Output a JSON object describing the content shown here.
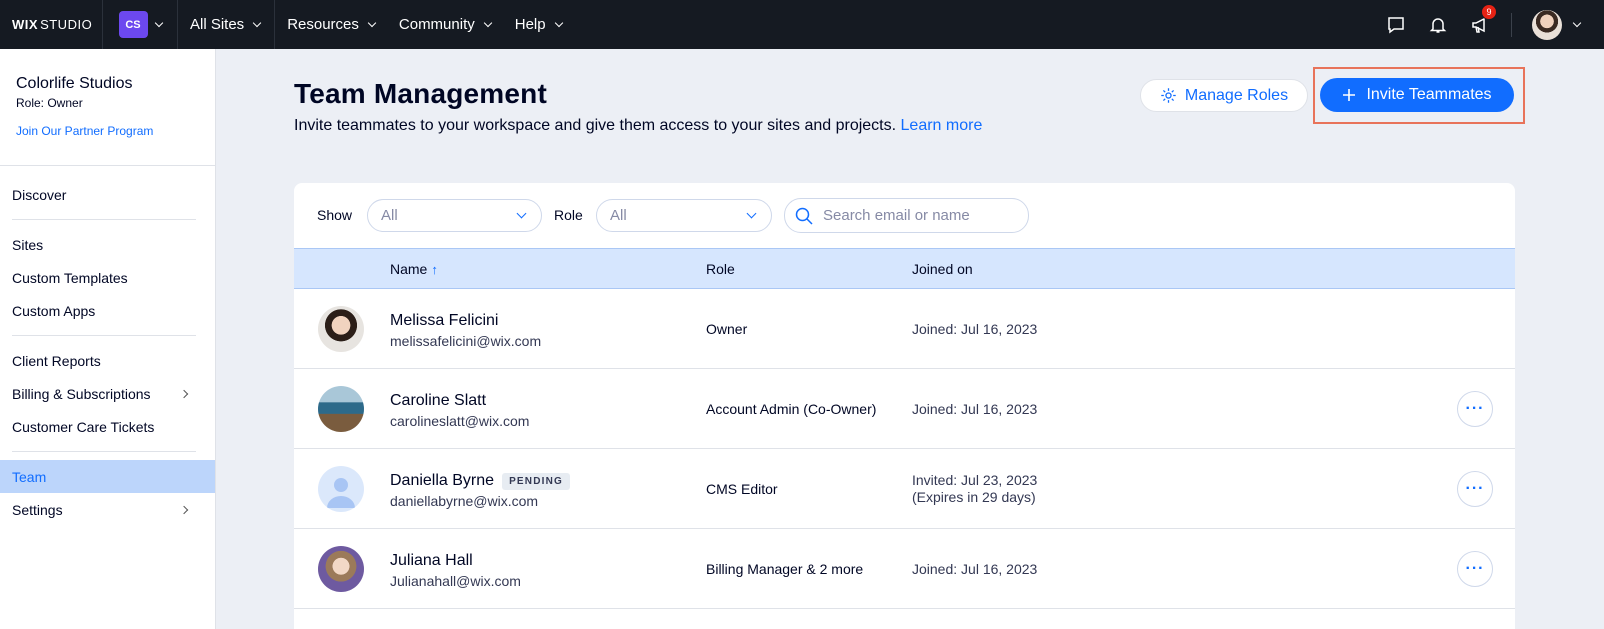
{
  "topbar": {
    "logo_brand": "WIX",
    "logo_product": "STUDIO",
    "workspace_badge": "CS",
    "nav": [
      {
        "label": "All Sites"
      },
      {
        "label": "Resources"
      },
      {
        "label": "Community"
      },
      {
        "label": "Help"
      }
    ],
    "notification_count": "9",
    "icons": [
      "chat-icon",
      "bell-icon",
      "megaphone-icon",
      "avatar"
    ]
  },
  "sidebar": {
    "workspace_name": "Colorlife Studios",
    "workspace_role": "Role: Owner",
    "partner_link": "Join Our Partner Program",
    "items": [
      {
        "label": "Discover"
      },
      {
        "label": "Sites"
      },
      {
        "label": "Custom Templates"
      },
      {
        "label": "Custom Apps"
      },
      {
        "label": "Client Reports"
      },
      {
        "label": "Billing & Subscriptions"
      },
      {
        "label": "Customer Care Tickets"
      },
      {
        "label": "Team"
      },
      {
        "label": "Settings"
      }
    ],
    "active_item": "Team"
  },
  "header": {
    "title": "Team Management",
    "subtitle": "Invite teammates to your workspace and give them access to your sites and projects.",
    "learn_more": "Learn more",
    "manage_roles_label": "Manage Roles",
    "invite_label": "Invite Teammates"
  },
  "filters": {
    "show_label": "Show",
    "show_value": "All",
    "role_label": "Role",
    "role_value": "All",
    "search_placeholder": "Search email or name"
  },
  "table": {
    "columns": [
      "Name",
      "Role",
      "Joined on"
    ],
    "sort_indicator": "↑",
    "rows": [
      {
        "name": "Melissa Felicini",
        "email": "melissafelicini@wix.com",
        "role": "Owner",
        "joined": "Joined: Jul 16, 2023",
        "joined_extra": "",
        "badge": ""
      },
      {
        "name": "Caroline Slatt",
        "email": "carolineslatt@wix.com",
        "role": "Account Admin (Co-Owner)",
        "joined": "Joined: Jul 16, 2023",
        "joined_extra": "",
        "badge": ""
      },
      {
        "name": "Daniella Byrne",
        "email": "daniellabyrne@wix.com",
        "role": "CMS Editor",
        "joined": "Invited: Jul 23, 2023",
        "joined_extra": "(Expires in 29 days)",
        "badge": "PENDING"
      },
      {
        "name": "Juliana Hall",
        "email": "Julianahall@wix.com",
        "role": "Billing Manager & 2 more",
        "joined": "Joined: Jul 16, 2023",
        "joined_extra": "",
        "badge": ""
      }
    ],
    "more_label": "···"
  },
  "colors": {
    "accent": "#116dff",
    "topbar_bg": "#151a22",
    "workspace_badge": "#6c48ef",
    "active_sidebar": "#bcd5fb",
    "highlight_outline": "#e8735a"
  }
}
